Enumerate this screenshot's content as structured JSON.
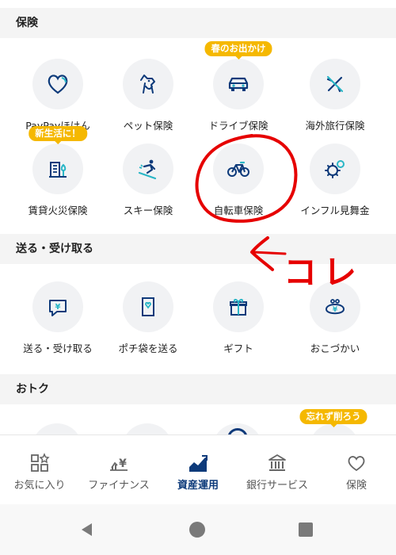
{
  "sections": {
    "insurance": {
      "title": "保険"
    },
    "send": {
      "title": "送る・受け取る"
    },
    "deals": {
      "title": "おトク"
    }
  },
  "insurance_items": [
    {
      "label": "PayPayほけん",
      "icon": "heart-icon"
    },
    {
      "label": "ペット保険",
      "icon": "dog-icon"
    },
    {
      "label": "ドライブ保険",
      "icon": "car-icon",
      "badge": "春のお出かけ"
    },
    {
      "label": "海外旅行保険",
      "icon": "airplane-icon"
    },
    {
      "label": "賃貸火災保険",
      "icon": "building-icon",
      "badge": "新生活に！"
    },
    {
      "label": "スキー保険",
      "icon": "skier-icon"
    },
    {
      "label": "自転車保険",
      "icon": "bicycle-icon"
    },
    {
      "label": "インフル見舞金",
      "icon": "virus-icon"
    }
  ],
  "send_items": [
    {
      "label": "送る・受け取る",
      "icon": "yen-chat-icon"
    },
    {
      "label": "ポチ袋を送る",
      "icon": "envelope-icon"
    },
    {
      "label": "ギフト",
      "icon": "gift-icon"
    },
    {
      "label": "おこづかい",
      "icon": "coin-purse-icon"
    }
  ],
  "deals_badge": "忘れず削ろう",
  "bottom_nav": [
    {
      "label": "お気に入り",
      "icon": "favorites-grid-icon",
      "active": false
    },
    {
      "label": "ファイナンス",
      "icon": "chart-yen-icon",
      "active": false
    },
    {
      "label": "資産運用",
      "icon": "area-chart-icon",
      "active": true
    },
    {
      "label": "銀行サービス",
      "icon": "bank-icon",
      "active": false
    },
    {
      "label": "保険",
      "icon": "heart-icon",
      "active": false
    }
  ],
  "annotation": {
    "text": "コレ",
    "color": "#e60000"
  },
  "colors": {
    "accent": "#0d3a7a",
    "teal": "#29b6c6",
    "badge": "#f5b800",
    "section_bg": "#f4f4f4"
  }
}
